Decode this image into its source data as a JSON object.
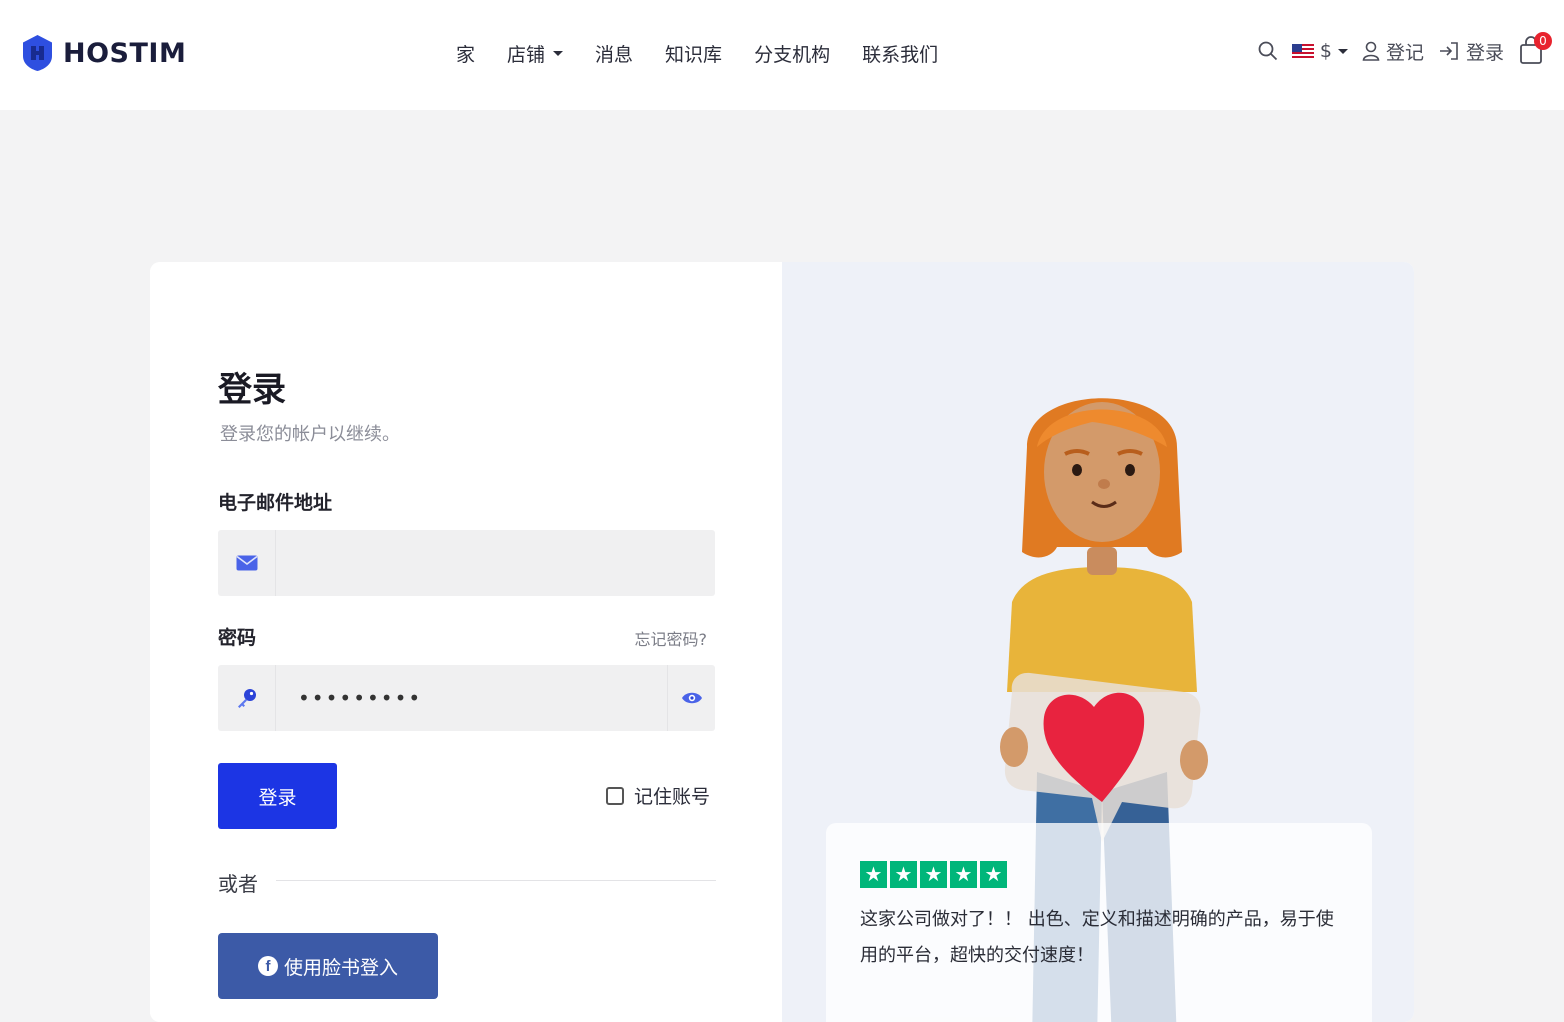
{
  "header": {
    "brand": "HOSTIM",
    "nav": [
      {
        "label": "家",
        "has_caret": false
      },
      {
        "label": "店铺",
        "has_caret": true
      },
      {
        "label": "消息",
        "has_caret": false
      },
      {
        "label": "知识库",
        "has_caret": false
      },
      {
        "label": "分支机构",
        "has_caret": false
      },
      {
        "label": "联系我们",
        "has_caret": false
      }
    ],
    "currency": "$",
    "register_label": "登记",
    "login_label": "登录",
    "cart_count": "0"
  },
  "form": {
    "title": "登录",
    "subtitle": "登录您的帐户以继续。",
    "email_label": "电子邮件地址",
    "email_value": "",
    "password_label": "密码",
    "password_value": "•••••••••",
    "forgot_label": "忘记密码?",
    "login_button": "登录",
    "remember_label": "记住账号",
    "or_label": "或者",
    "facebook_button": "使用脸书登入"
  },
  "review": {
    "rating": 5,
    "text": "这家公司做对了！！ 出色、定义和描述明确的产品，易于使用的平台，超快的交付速度！"
  },
  "colors": {
    "primary": "#1c35e4",
    "facebook": "#3c5aa7",
    "trustpilot": "#00b67a",
    "badge": "#e8232e"
  }
}
